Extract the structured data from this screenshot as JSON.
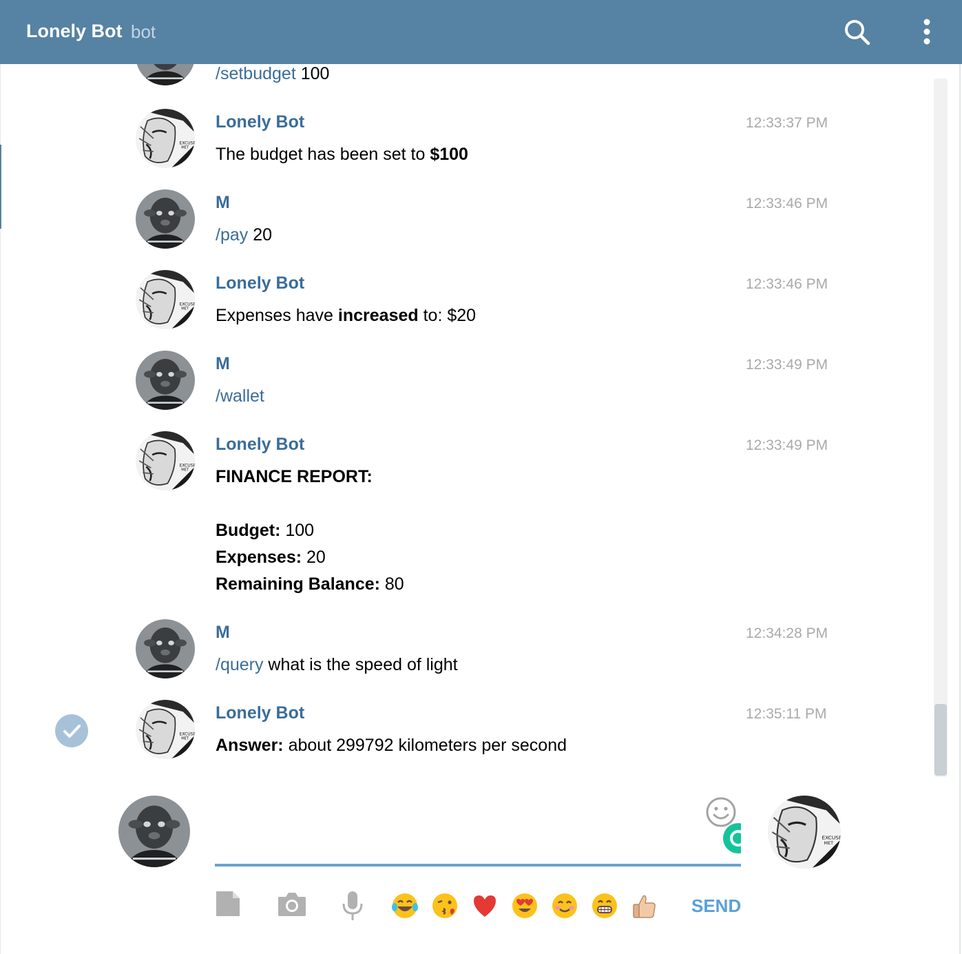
{
  "header": {
    "title": "Lonely Bot",
    "subtitle": "bot",
    "search_icon": "search-icon",
    "menu_icon": "more-vertical-icon"
  },
  "messages": [
    {
      "author": "",
      "time": "",
      "cmd": "/setbudget",
      "text": " 100"
    },
    {
      "author": "Lonely Bot",
      "time": "12:33:37 PM",
      "text_pre": "The budget has been set to ",
      "text_bold": "$100"
    },
    {
      "author": "M",
      "time": "12:33:46 PM",
      "cmd": "/pay",
      "text": " 20"
    },
    {
      "author": "Lonely Bot",
      "time": "12:33:46 PM",
      "text_pre": "Expenses have ",
      "text_bold": "increased",
      "text_post": " to: $20"
    },
    {
      "author": "M",
      "time": "12:33:49 PM",
      "cmd": "/wallet",
      "text": ""
    },
    {
      "author": "Lonely Bot",
      "time": "12:33:49 PM",
      "report_title": "FINANCE REPORT:",
      "budget_label": "Budget:",
      "budget_value": " 100",
      "expenses_label": "Expenses:",
      "expenses_value": " 20",
      "remaining_label": "Remaining Balance:",
      "remaining_value": " 80"
    },
    {
      "author": "M",
      "time": "12:34:28 PM",
      "cmd": "/query",
      "text": " what is the speed of light"
    },
    {
      "author": "Lonely Bot",
      "time": "12:35:11 PM",
      "text_bold": "Answer:",
      "text_post": " about 299792 kilometers per second"
    }
  ],
  "composer": {
    "placeholder": "",
    "send_label": "SEND",
    "tools": [
      "document-icon",
      "camera-icon",
      "microphone-icon"
    ],
    "emojis": [
      "😂",
      "😘",
      "❤️",
      "😍",
      "😊",
      "😁",
      "👍🏼"
    ]
  },
  "colors": {
    "header_bg": "#5682a3",
    "accent": "#3a6d99",
    "send": "#5aa0d9",
    "input_line": "#68a3ce"
  }
}
